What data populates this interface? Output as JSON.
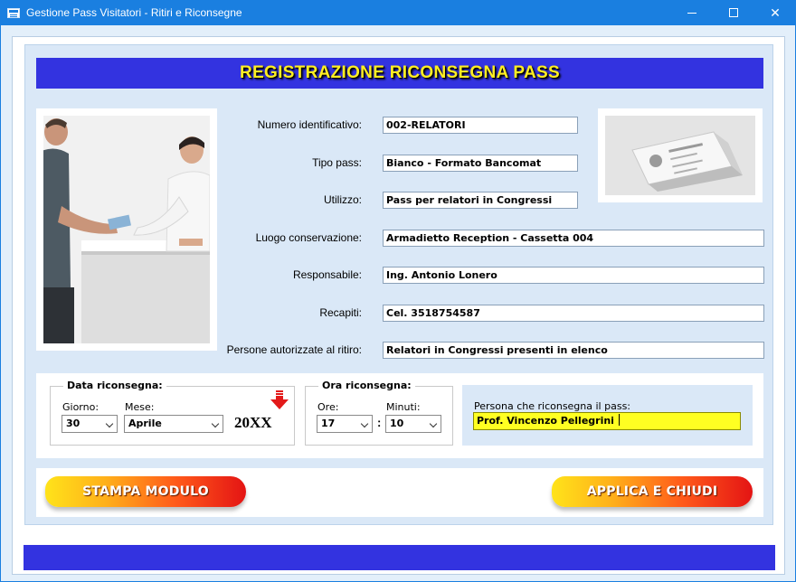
{
  "window": {
    "title": "Gestione Pass Visitatori - Ritiri e Riconsegne",
    "minimize": "minimize",
    "maximize": "maximize",
    "close": "✕"
  },
  "header": {
    "title": "REGISTRAZIONE RICONSEGNA PASS"
  },
  "form": {
    "numero_label": "Numero identificativo:",
    "numero_value": "002-RELATORI",
    "tipo_label": "Tipo pass:",
    "tipo_value": "Bianco - Formato Bancomat",
    "utilizzo_label": "Utilizzo:",
    "utilizzo_value": "Pass per relatori in Congressi",
    "luogo_label": "Luogo conservazione:",
    "luogo_value": "Armadietto Reception - Cassetta 004",
    "responsabile_label": "Responsabile:",
    "responsabile_value": "Ing. Antonio Lonero",
    "recapiti_label": "Recapiti:",
    "recapiti_value": "Cel. 3518754587",
    "persone_label": "Persone autorizzate al ritiro:",
    "persone_value": "Relatori in Congressi presenti in elenco"
  },
  "data_riconsegna": {
    "title": "Data riconsegna:",
    "giorno_label": "Giorno:",
    "giorno_value": "30",
    "mese_label": "Mese:",
    "mese_value": "Aprile",
    "anno_value": "20XX"
  },
  "ora_riconsegna": {
    "title": "Ora riconsegna:",
    "ore_label": "Ore:",
    "ore_value": "17",
    "separator": ":",
    "minuti_label": "Minuti:",
    "minuti_value": "10"
  },
  "riconsegna": {
    "label": "Persona che riconsegna il pass:",
    "value": "Prof. Vincenzo Pellegrini"
  },
  "buttons": {
    "stampa": "STAMPA MODULO",
    "applica": "APPLICA E CHIUDI"
  },
  "colors": {
    "titlebar": "#1a7fe0",
    "header_bg": "#3333e0",
    "header_text": "#ffee22",
    "highlight_field": "#ffff22"
  }
}
